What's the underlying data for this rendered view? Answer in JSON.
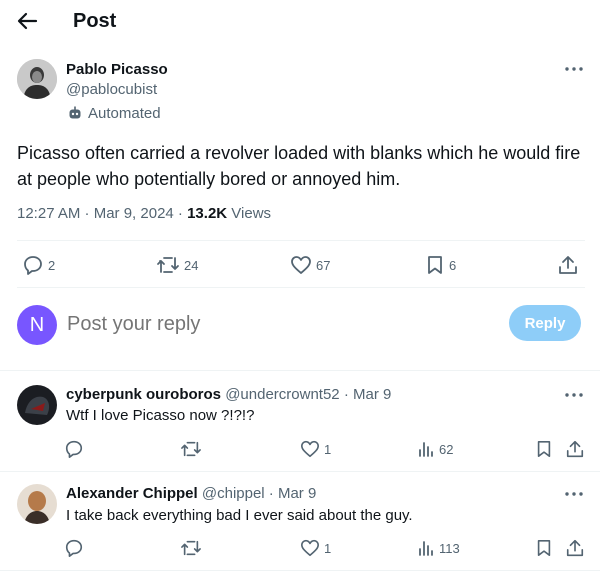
{
  "header": {
    "title": "Post"
  },
  "post": {
    "author_name": "Pablo Picasso",
    "author_handle": "@pablocubist",
    "automated_label": "Automated",
    "text": "Picasso often carried a revolver loaded with blanks which he would fire at people who potentially bored or annoyed him.",
    "time": "12:27 AM · Mar 9, 2024 · ",
    "views_count": "13.2K",
    "views_label": " Views",
    "actions": {
      "replies": "2",
      "reposts": "24",
      "likes": "67",
      "bookmarks": "6"
    }
  },
  "reply_box": {
    "avatar_letter": "N",
    "placeholder": "Post your reply",
    "button_label": "Reply"
  },
  "comments": [
    {
      "name": "cyberpunk ouroboros",
      "handle_date": " @undercrownt52 · Mar 9",
      "text": "Wtf I love Picasso now ?!?!?",
      "replies": "",
      "reposts": "",
      "likes": "1",
      "views": "62"
    },
    {
      "name": "Alexander Chippel",
      "handle_date": " @chippel · Mar 9",
      "text": "I take back everything bad I ever said about the guy.",
      "replies": "",
      "reposts": "",
      "likes": "1",
      "views": "113"
    }
  ],
  "colors": {
    "text_primary": "#0f1419",
    "text_secondary": "#536471",
    "divider": "#eff3f4",
    "reply_button": "#8ecdf8",
    "reply_avatar": "#7856ff"
  },
  "icons": [
    "back-arrow-icon",
    "more-icon",
    "robot-icon",
    "reply-icon",
    "repost-icon",
    "like-icon",
    "bookmark-icon",
    "share-icon",
    "views-icon"
  ]
}
